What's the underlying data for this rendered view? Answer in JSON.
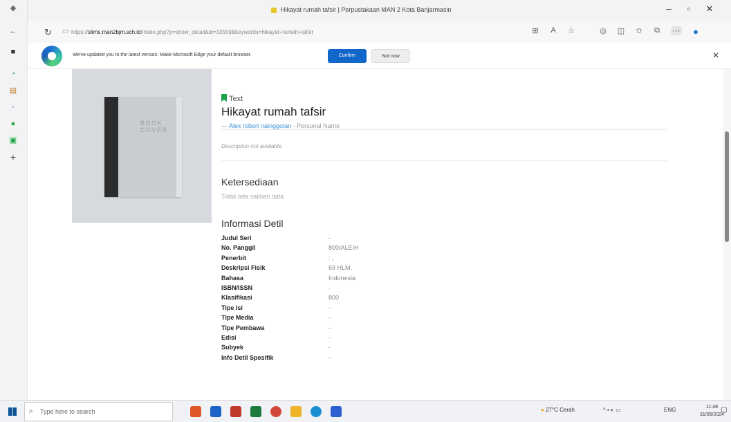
{
  "window": {
    "title": "Hikayat rumah tafsir | Perpustakaan MAN 2 Kota Banjarmasin"
  },
  "address_bar": {
    "url_prefix": "https://",
    "url_domain": "slims.man2bjm.sch.id",
    "url_rest": "/index.php?p=show_detail&id=33559&keywords=hikayat+rumah+tafsir"
  },
  "infobar": {
    "message": "We've updated you to the latest version. Make Microsoft Edge your default browser.",
    "confirm_label": "Confirm",
    "not_now_label": "Not now",
    "close_icon": "close-icon"
  },
  "book": {
    "cover_text": "BOOK COVER",
    "type_label": "Text",
    "title": "Hikayat rumah tafsir",
    "author_prefix": "— ",
    "author": "Alex robert nainggolan",
    "author_role": " - Personal Name",
    "description": "Description not available",
    "availability_heading": "Ketersediaan",
    "availability_text": "Tidak ada salinan data",
    "detail_heading": "Informasi Detil",
    "details": [
      {
        "key": "Judul Seri",
        "value": "-"
      },
      {
        "key": "No. Panggil",
        "value": "800/ALE/H"
      },
      {
        "key": "Penerbit",
        "value": ": ,"
      },
      {
        "key": "Deskripsi Fisik",
        "value": "69 HLM."
      },
      {
        "key": "Bahasa",
        "value": "Indonesia"
      },
      {
        "key": "ISBN/ISSN",
        "value": "-"
      },
      {
        "key": "Klasifikasi",
        "value": "800"
      },
      {
        "key": "Tipe Isi",
        "value": "-"
      },
      {
        "key": "Tipe Media",
        "value": "-"
      },
      {
        "key": "Tipe Pembawa",
        "value": "-"
      },
      {
        "key": "Edisi",
        "value": "-"
      },
      {
        "key": "Subyek",
        "value": "-"
      },
      {
        "key": "Info Detil Spesifik",
        "value": "-"
      }
    ]
  },
  "taskbar": {
    "search_placeholder": "Type here to search",
    "weather": "27°C Cerah",
    "language": "ENG",
    "time": "11:48",
    "date": "31/05/2024"
  },
  "colors": {
    "accent": "#1166c9",
    "link": "#3b8fd6",
    "bookmark": "#1ea34a"
  }
}
